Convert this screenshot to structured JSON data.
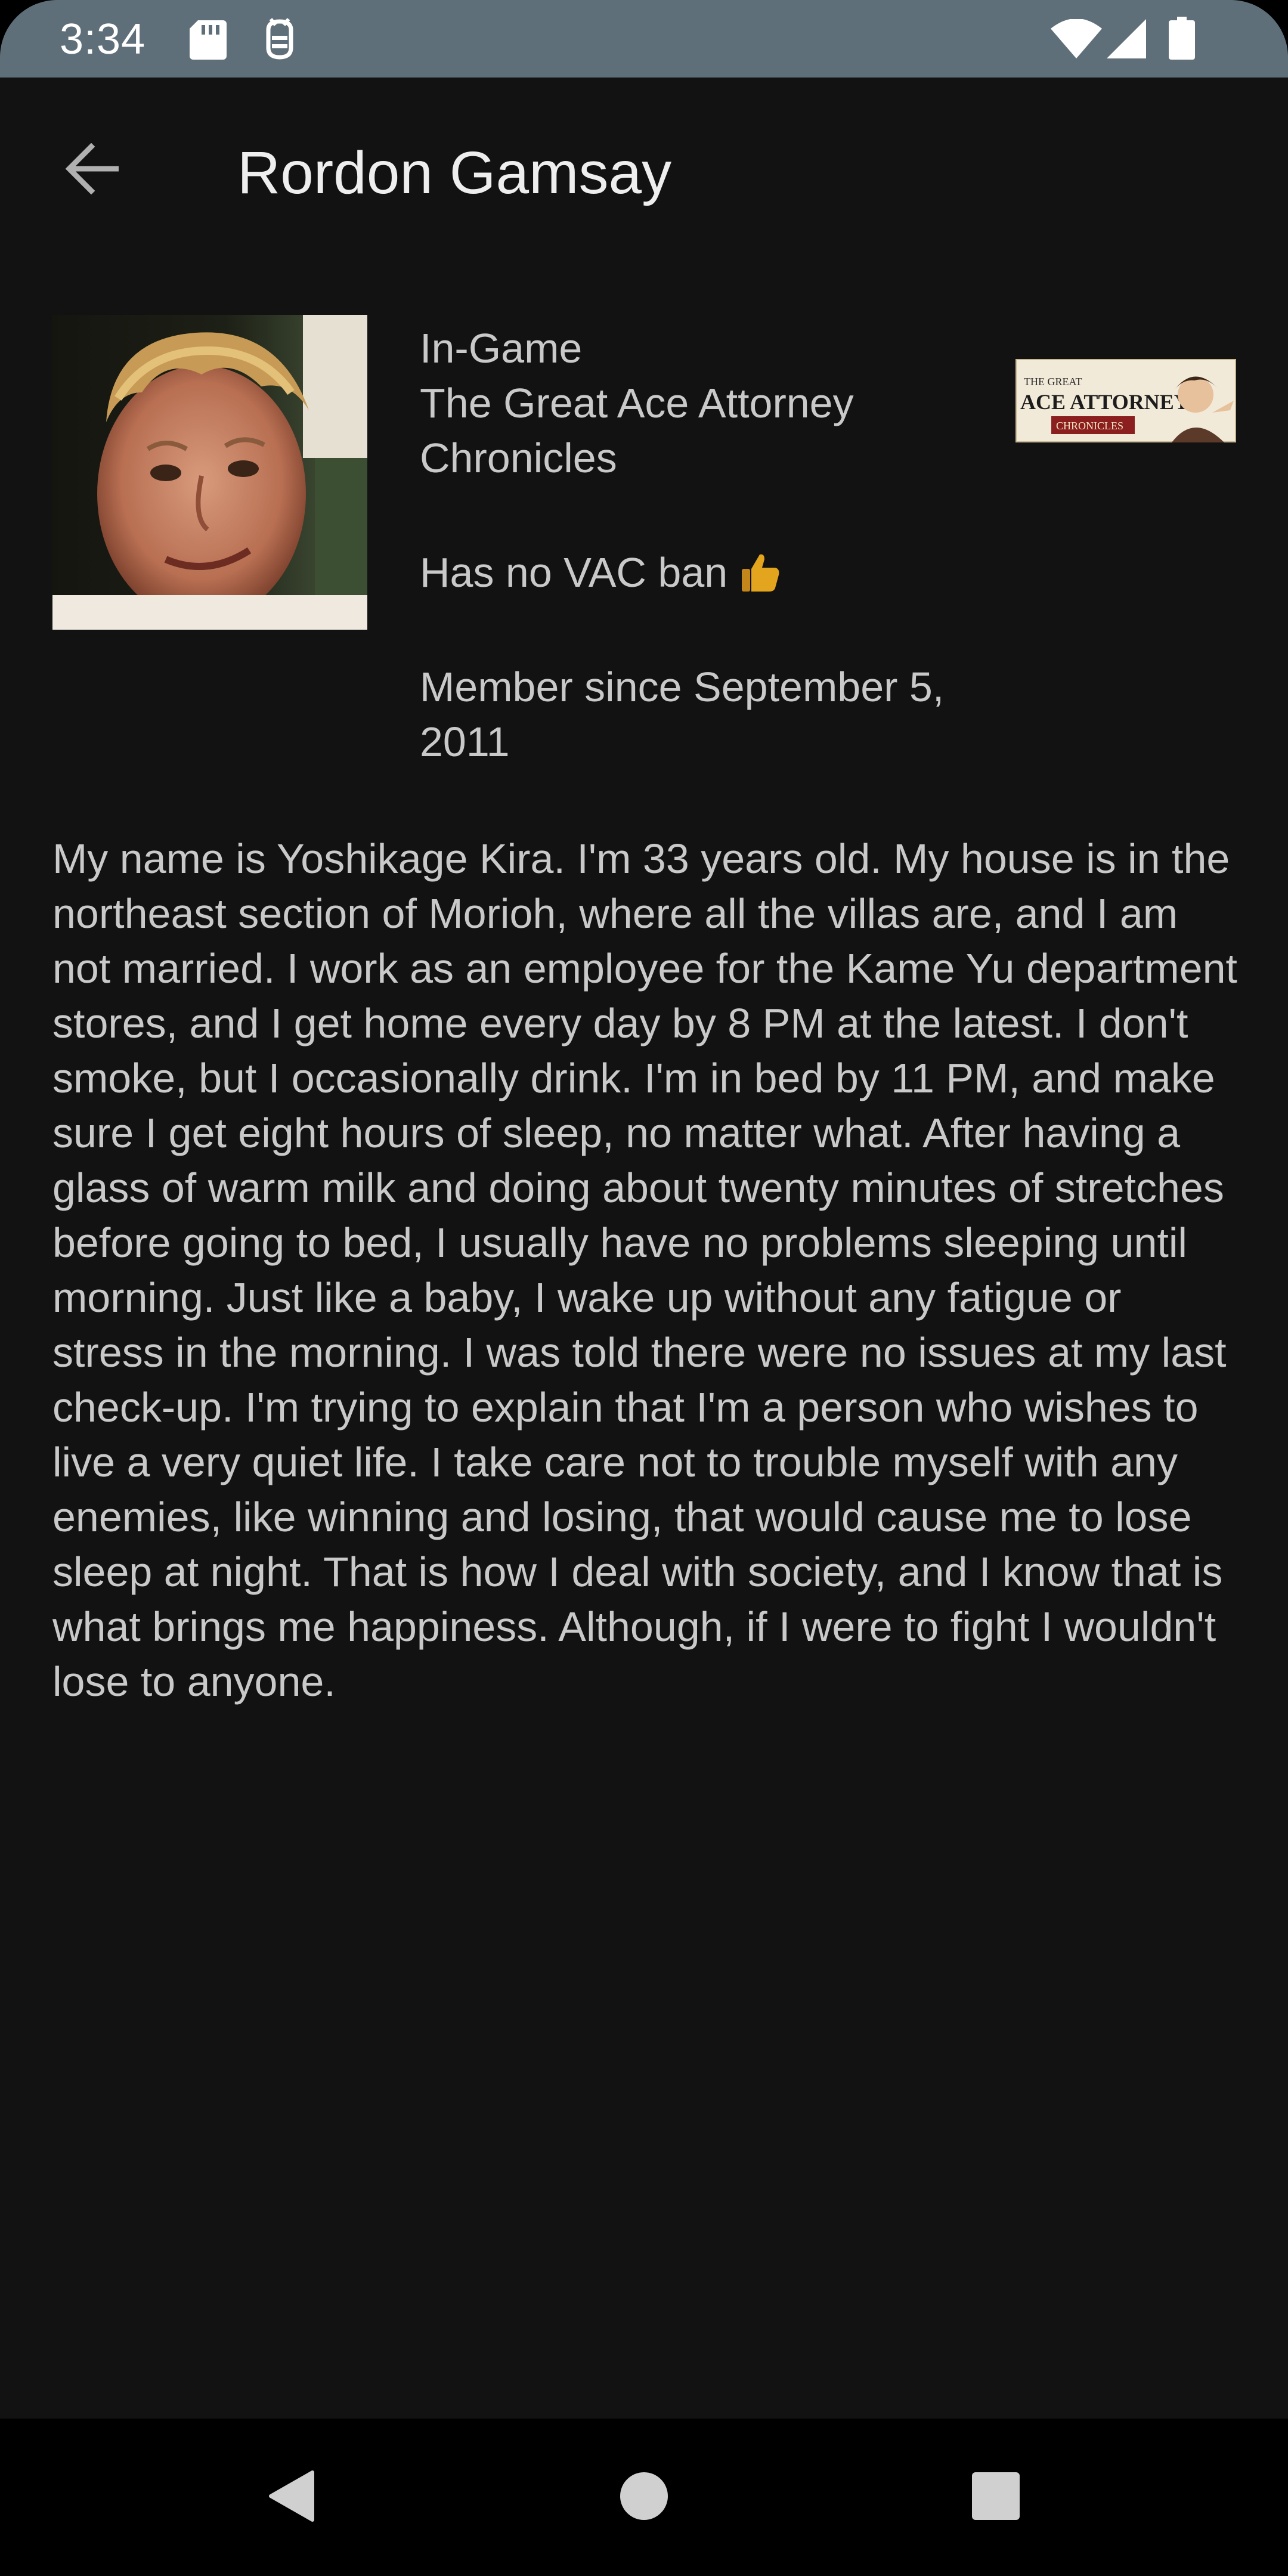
{
  "status_bar": {
    "time": "3:34",
    "icons": [
      "sd-card-icon",
      "debug-icon",
      "wifi-icon",
      "cellular-signal-icon",
      "battery-icon"
    ]
  },
  "app_bar": {
    "title": "Rordon Gamsay",
    "back_icon": "arrow-back-icon"
  },
  "profile": {
    "status": "In-Game",
    "game_name": "The Great Ace Attorney Chronicles",
    "vac_status": "Has no VAC ban",
    "member_since": "Member since September 5, 2011",
    "bio": "My name is Yoshikage Kira. I'm 33 years old. My house is in the northeast section of Morioh, where all the villas are, and I am not married. I work as an employee for the Kame Yu department stores, and I get home every day by 8 PM at the latest. I don't smoke, but I occasionally drink. I'm in bed by 11 PM, and make sure I get eight hours of sleep, no matter what. After having a glass of warm milk and doing about twenty minutes of stretches before going to bed, I usually have no problems sleeping until morning. Just like a baby, I wake up without any fatigue or stress in the morning. I was told there were no issues at my last check-up. I'm trying to explain that I'm a person who wishes to live a very quiet life. I take care not to trouble myself with any enemies, like winning and losing, that would cause me to lose sleep at night. That is how I deal with society, and I know that is what brings me happiness. Although, if I were to fight I wouldn't lose to anyone."
  },
  "game_banner": {
    "line1": "THE GREAT",
    "line2": "ACE ATTORNEY",
    "line3": "CHRONICLES"
  },
  "nav_bar": {
    "buttons": [
      "back-triangle-icon",
      "home-circle-icon",
      "recents-square-icon"
    ]
  },
  "colors": {
    "background": "#121212",
    "status_bar": "#5f6f79",
    "text": "#c9c9c9",
    "title": "#eeeeee"
  }
}
